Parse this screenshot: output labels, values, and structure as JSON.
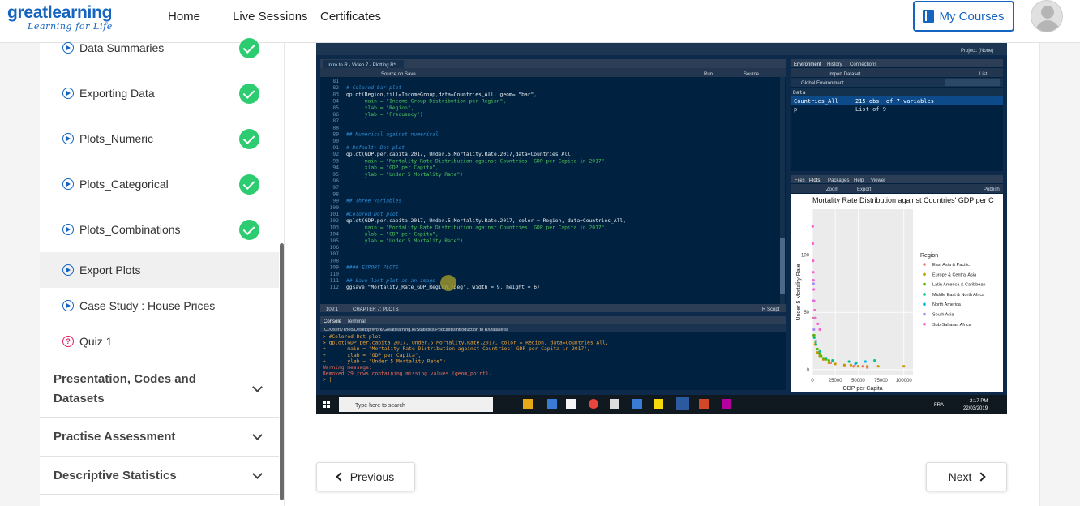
{
  "header": {
    "brand": "greatlearning",
    "tagline": "Learning for Life",
    "nav": [
      "Home",
      "Live Sessions",
      "Certificates"
    ],
    "my_courses": "My Courses"
  },
  "sidebar": {
    "lessons": [
      {
        "label": "Data Summaries",
        "done": true
      },
      {
        "label": "Exporting Data",
        "done": true
      },
      {
        "label": "Plots_Numeric",
        "done": true
      },
      {
        "label": "Plots_Categorical",
        "done": true
      },
      {
        "label": "Plots_Combinations",
        "done": true
      },
      {
        "label": "Export Plots",
        "done": false
      },
      {
        "label": "Case Study : House Prices",
        "done": false
      },
      {
        "label": "Quiz 1",
        "done": false
      }
    ],
    "sections": [
      {
        "label": "Presentation, Codes and Datasets"
      },
      {
        "label": "Practise Assessment"
      },
      {
        "label": "Descriptive Statistics"
      }
    ]
  },
  "video": {
    "tab_title": "Intro to R - Video 7 - Plotting R*",
    "toolbar_source_on_save": "Source on Save",
    "run": "Run",
    "source": "Source",
    "project": "Project: (None)",
    "code_lines": [
      {
        "n": "81",
        "t": ""
      },
      {
        "n": "82",
        "t": "# Colored bar plot",
        "c": "comment"
      },
      {
        "n": "83",
        "t": "qplot(Region,fill=IncomeGroup,data=Countries_All, geom= \"bar\","
      },
      {
        "n": "84",
        "t": "      main = \"Income Group Distribution per Region\",",
        "c": "str"
      },
      {
        "n": "85",
        "t": "      xlab = \"Region\",",
        "c": "str"
      },
      {
        "n": "86",
        "t": "      ylab = \"Frequency\")",
        "c": "str"
      },
      {
        "n": "87",
        "t": ""
      },
      {
        "n": "88",
        "t": ""
      },
      {
        "n": "89",
        "t": "## Numerical against numerical",
        "c": "comment"
      },
      {
        "n": "90",
        "t": ""
      },
      {
        "n": "91",
        "t": "# Default: Dot plot",
        "c": "comment"
      },
      {
        "n": "92",
        "t": "qplot(GDP.per.capita.2017, Under.5.Mortality.Rate.2017,data=Countries_All,"
      },
      {
        "n": "93",
        "t": "      main = \"Mortality Rate Distribution against Countries' GDP per Capita in 2017\",",
        "c": "str"
      },
      {
        "n": "94",
        "t": "      xlab = \"GDP per Capita\",",
        "c": "str"
      },
      {
        "n": "95",
        "t": "      ylab = \"Under 5 Mortality Rate\")",
        "c": "str"
      },
      {
        "n": "96",
        "t": ""
      },
      {
        "n": "97",
        "t": ""
      },
      {
        "n": "98",
        "t": ""
      },
      {
        "n": "99",
        "t": "## Three variables",
        "c": "comment"
      },
      {
        "n": "100",
        "t": ""
      },
      {
        "n": "101",
        "t": "#Colored Dot plot",
        "c": "comment"
      },
      {
        "n": "102",
        "t": "qplot(GDP.per.capita.2017, Under.5.Mortality.Rate.2017, color = Region, data=Countries_All,"
      },
      {
        "n": "103",
        "t": "      main = \"Mortality Rate Distribution against Countries' GDP per Capita in 2017\",",
        "c": "str"
      },
      {
        "n": "104",
        "t": "      xlab = \"GDP per Capita\",",
        "c": "str"
      },
      {
        "n": "105",
        "t": "      ylab = \"Under 5 Mortality Rate\")",
        "c": "str"
      },
      {
        "n": "106",
        "t": ""
      },
      {
        "n": "107",
        "t": ""
      },
      {
        "n": "108",
        "t": ""
      },
      {
        "n": "109",
        "t": "#### EXPORT PLOTS",
        "c": "comment"
      },
      {
        "n": "110",
        "t": ""
      },
      {
        "n": "111",
        "t": "## Save last plot as an image",
        "c": "comment"
      },
      {
        "n": "112",
        "t": "ggsave(\"Mortality_Rate_GDP_Region.jpeg\", width = 9, height = 6)"
      }
    ],
    "status_left": "109:1",
    "status_chapter": "CHAPTER 7: PLOTS",
    "status_right": "R Script",
    "console_tabs": [
      "Console",
      "Terminal"
    ],
    "console_path": "C:/Users/Theo/Desktop/Work/Greatlearning.ie/Statistics Podcasts/Introduction to R/Datasets/",
    "console_lines": [
      {
        "t": "> #Colored Dot plot",
        "c": "cmd"
      },
      {
        "t": "> qplot(GDP.per.capita.2017, Under.5.Mortality.Rate.2017, color = Region, data=Countries_All,",
        "c": "cmd"
      },
      {
        "t": "+       main = \"Mortality Rate Distribution against Countries' GDP per Capita in 2017\",",
        "c": "cmd"
      },
      {
        "t": "+       xlab = \"GDP per Capita\",",
        "c": "cmd"
      },
      {
        "t": "+       ylab = \"Under 5 Mortality Rate\")",
        "c": "cmd"
      },
      {
        "t": "Warning message:",
        "c": "warn"
      },
      {
        "t": "Removed 29 rows containing missing values (geom_point).",
        "c": "warn"
      },
      {
        "t": "> |",
        "c": "cmd"
      }
    ],
    "env_tabs": [
      "Environment",
      "History",
      "Connections"
    ],
    "env_import": "Import Dataset",
    "env_scope": "Global Environment",
    "env_list": "List",
    "env_data_header": "Data",
    "env_rows": [
      {
        "name": "Countries_All",
        "value": "215 obs. of 7 variables"
      },
      {
        "name": "p",
        "value": "List of 9"
      }
    ],
    "files_tabs": [
      "Files",
      "Plots",
      "Packages",
      "Help",
      "Viewer"
    ],
    "plot_zoom": "Zoom",
    "plot_export": "Export",
    "plot_publish": "Publish",
    "taskbar_search": "Type here to search",
    "taskbar_time": "2:17 PM",
    "taskbar_date": "22/03/2019",
    "taskbar_lang": "FRA"
  },
  "chart_data": {
    "type": "scatter",
    "title": "Mortality Rate Distribution against Countries' GDP per C",
    "xlabel": "GDP per Capita",
    "ylabel": "Under 5 Mortality Rate",
    "xlim": [
      0,
      110000
    ],
    "ylim": [
      -5,
      140
    ],
    "x_ticks": [
      0,
      25000,
      50000,
      75000,
      100000
    ],
    "y_ticks": [
      0,
      50,
      100
    ],
    "legend_title": "Region",
    "legend_position": "right",
    "series": [
      {
        "name": "East Asia & Pacific",
        "color": "#f8766d",
        "x": [
          800,
          2000,
          3500,
          6000,
          9000,
          12000,
          20000,
          35000,
          45000,
          55000,
          60000
        ],
        "y": [
          45,
          30,
          22,
          15,
          12,
          9,
          6,
          4,
          3,
          3,
          2
        ]
      },
      {
        "name": "Europe & Central Asia",
        "color": "#c49a00",
        "x": [
          3000,
          5000,
          8000,
          12000,
          18000,
          25000,
          35000,
          42000,
          50000,
          60000,
          72000,
          100000
        ],
        "y": [
          22,
          15,
          12,
          9,
          6,
          5,
          4,
          4,
          3,
          3,
          3,
          3
        ]
      },
      {
        "name": "Latin America & Caribbean",
        "color": "#53b400",
        "x": [
          1500,
          3500,
          5500,
          7500,
          9500,
          12000,
          15000,
          18000
        ],
        "y": [
          30,
          24,
          18,
          14,
          12,
          10,
          9,
          8
        ]
      },
      {
        "name": "Middle East & North Africa",
        "color": "#00c094",
        "x": [
          2000,
          4000,
          8000,
          15000,
          22000,
          40000,
          48000,
          68000
        ],
        "y": [
          28,
          22,
          16,
          10,
          8,
          7,
          6,
          8
        ]
      },
      {
        "name": "North America",
        "color": "#00b6eb",
        "x": [
          47000,
          58000
        ],
        "y": [
          5,
          7
        ]
      },
      {
        "name": "South Asia",
        "color": "#a58aff",
        "x": [
          700,
          1100,
          1600,
          2300,
          3800
        ],
        "y": [
          60,
          75,
          35,
          45,
          25
        ]
      },
      {
        "name": "Sub-Saharan Africa",
        "color": "#fb61d7",
        "x": [
          300,
          500,
          700,
          900,
          1100,
          1400,
          1800,
          2500,
          3500,
          6000,
          8000
        ],
        "y": [
          125,
          110,
          95,
          85,
          78,
          70,
          60,
          52,
          45,
          40,
          35
        ]
      }
    ]
  }
}
